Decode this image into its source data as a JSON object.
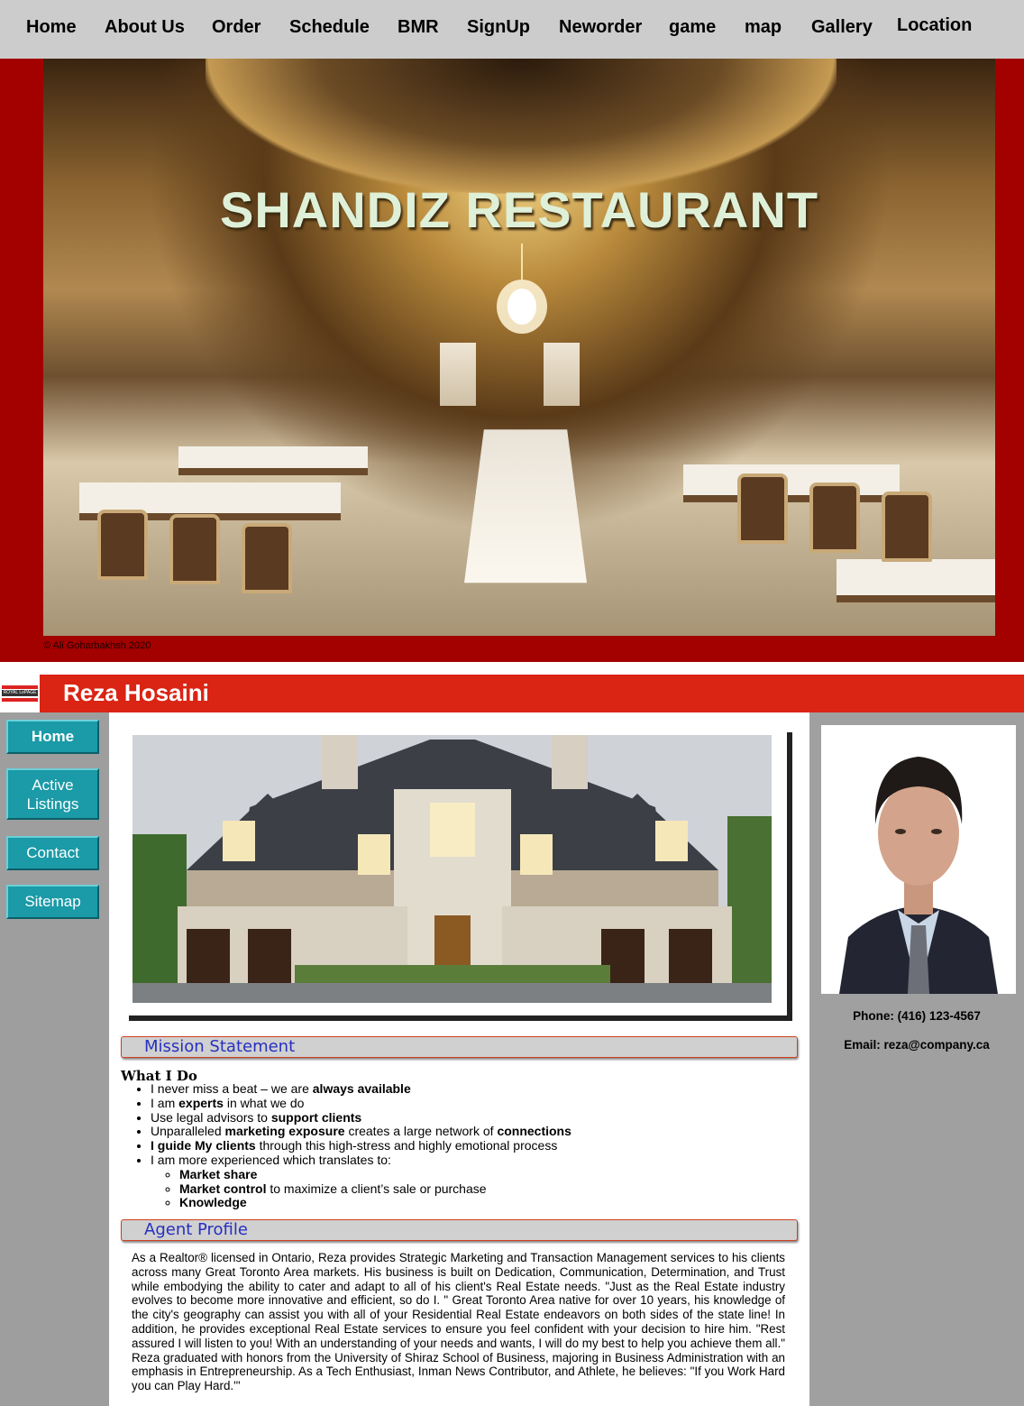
{
  "nav": {
    "items": [
      "Home",
      "About Us",
      "Order",
      "Schedule",
      "BMR",
      "SignUp",
      "Neworder",
      "game",
      "map",
      "Gallery",
      "Location"
    ]
  },
  "hero": {
    "title": "SHANDIZ RESTAURANT",
    "credit": "© Ali Goharbakhsh 2020"
  },
  "agent": {
    "logo_text": "ROYAL LePAGE",
    "name": "Reza Hosaini",
    "phone": "Phone: (416) 123-4567",
    "email": "Email: reza@company.ca"
  },
  "sidebar": {
    "items": [
      {
        "label": "Home"
      },
      {
        "label": "Active Listings"
      },
      {
        "label": "Contact"
      },
      {
        "label": "Sitemap"
      }
    ]
  },
  "mission": {
    "heading": "Mission Statement",
    "subheading": "What I Do",
    "bullets": [
      {
        "pre": "I never miss a beat – we are ",
        "bold": "always available",
        "post": ""
      },
      {
        "pre": "I am ",
        "bold": "experts",
        "post": " in what we do"
      },
      {
        "pre": "Use legal advisors to ",
        "bold": "support clients",
        "post": ""
      },
      {
        "pre": "Unparalleled ",
        "bold": "marketing exposure",
        "post": " creates a large network of ",
        "bold2": "connections"
      },
      {
        "pre": "",
        "bold": "I guide My clients",
        "post": " through this high-stress and highly emotional process"
      },
      {
        "pre": "I am more experienced which translates to:",
        "bold": "",
        "post": ""
      }
    ],
    "sub_bullets": [
      {
        "bold": "Market share",
        "post": ""
      },
      {
        "bold": "Market control",
        "post": " to maximize a client’s sale or purchase"
      },
      {
        "bold": "Knowledge",
        "post": ""
      }
    ]
  },
  "profile": {
    "heading": "Agent Profile",
    "text": "As a Realtor® licensed in Ontario, Reza provides Strategic Marketing and Transaction Management services to his clients across many Great Toronto Area markets. His business is built on Dedication, Communication, Determination, and Trust while embodying the ability to cater and adapt to all of his client's Real Estate needs. \"Just as the Real Estate industry evolves to become more innovative and efficient, so do I. \" Great Toronto Area native for over 10 years, his knowledge of the city's geography can assist you with all of your Residential Real Estate endeavors on both sides of the state line! In addition, he provides exceptional Real Estate services to ensure you feel confident with your decision to hire him. \"Rest assured I will listen to you! With an understanding of your needs and wants, I will do my best to help you achieve them all.\" Reza graduated with honors from the University of Shiraz School of Business, majoring in Business Administration with an emphasis in Entrepreneurship. As a Tech Enthusiast, Inman News Contributor, and Athlete, he believes: \"If you Work Hard you can Play Hard.'\""
  },
  "colors": {
    "nav_bg": "#cccccc",
    "hero_bg": "#a30000",
    "agent_bar": "#da2414",
    "sidebar_button": "#1b9aa7",
    "section_heading_text": "#2630c0"
  }
}
